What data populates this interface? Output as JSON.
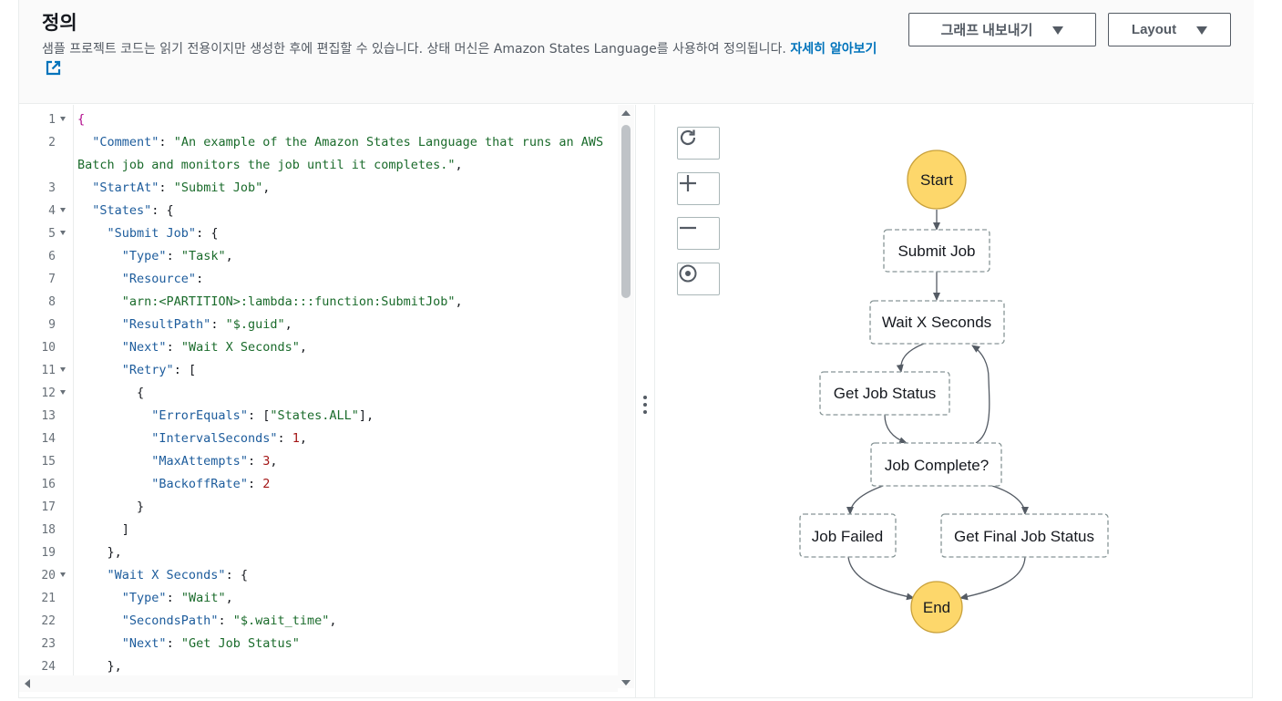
{
  "header": {
    "title": "정의",
    "description": "샘플 프로젝트 코드는 읽기 전용이지만 생성한 후에 편집할 수 있습니다. 상태 머신은 Amazon States Language를 사용하여 정의됩니다.",
    "learn_more": "자세히 알아보기",
    "export_button": "그래프 내보내기",
    "layout_button": "Layout"
  },
  "editor": {
    "lines": [
      {
        "n": "1",
        "fold": true,
        "html": "<span class='b'>{</span>"
      },
      {
        "n": "2",
        "fold": false,
        "html": "  <span class='k'>\"Comment\"</span>: <span class='s'>\"An example of the Amazon States Language that runs an AWS</span>"
      },
      {
        "n": "",
        "fold": false,
        "html": "<span class='s'>Batch job and monitors the job until it completes.\"</span>,"
      },
      {
        "n": "3",
        "fold": false,
        "html": "  <span class='k'>\"StartAt\"</span>: <span class='s'>\"Submit Job\"</span>,"
      },
      {
        "n": "4",
        "fold": true,
        "html": "  <span class='k'>\"States\"</span>: {"
      },
      {
        "n": "5",
        "fold": true,
        "html": "    <span class='k'>\"Submit Job\"</span>: {"
      },
      {
        "n": "6",
        "fold": false,
        "html": "      <span class='k'>\"Type\"</span>: <span class='s'>\"Task\"</span>,"
      },
      {
        "n": "7",
        "fold": false,
        "html": "      <span class='k'>\"Resource\"</span>:"
      },
      {
        "n": "8",
        "fold": false,
        "html": "      <span class='s'>\"arn:&lt;PARTITION&gt;:lambda:::function:SubmitJob\"</span>,"
      },
      {
        "n": "9",
        "fold": false,
        "html": "      <span class='k'>\"ResultPath\"</span>: <span class='s'>\"$.guid\"</span>,"
      },
      {
        "n": "10",
        "fold": false,
        "html": "      <span class='k'>\"Next\"</span>: <span class='s'>\"Wait X Seconds\"</span>,"
      },
      {
        "n": "11",
        "fold": true,
        "html": "      <span class='k'>\"Retry\"</span>: ["
      },
      {
        "n": "12",
        "fold": true,
        "html": "        {"
      },
      {
        "n": "13",
        "fold": false,
        "html": "          <span class='k'>\"ErrorEquals\"</span>: [<span class='s'>\"States.ALL\"</span>],"
      },
      {
        "n": "14",
        "fold": false,
        "html": "          <span class='k'>\"IntervalSeconds\"</span>: <span class='n'>1</span>,"
      },
      {
        "n": "15",
        "fold": false,
        "html": "          <span class='k'>\"MaxAttempts\"</span>: <span class='n'>3</span>,"
      },
      {
        "n": "16",
        "fold": false,
        "html": "          <span class='k'>\"BackoffRate\"</span>: <span class='n'>2</span>"
      },
      {
        "n": "17",
        "fold": false,
        "html": "        }"
      },
      {
        "n": "18",
        "fold": false,
        "html": "      ]"
      },
      {
        "n": "19",
        "fold": false,
        "html": "    },"
      },
      {
        "n": "20",
        "fold": true,
        "html": "    <span class='k'>\"Wait X Seconds\"</span>: {"
      },
      {
        "n": "21",
        "fold": false,
        "html": "      <span class='k'>\"Type\"</span>: <span class='s'>\"Wait\"</span>,"
      },
      {
        "n": "22",
        "fold": false,
        "html": "      <span class='k'>\"SecondsPath\"</span>: <span class='s'>\"$.wait_time\"</span>,"
      },
      {
        "n": "23",
        "fold": false,
        "html": "      <span class='k'>\"Next\"</span>: <span class='s'>\"Get Job Status\"</span>"
      },
      {
        "n": "24",
        "fold": false,
        "html": "    },"
      }
    ]
  },
  "graph": {
    "controls": [
      "refresh-icon",
      "zoom-in-icon",
      "zoom-out-icon",
      "center-icon"
    ],
    "nodes": {
      "start": "Start",
      "submit": "Submit Job",
      "wait": "Wait X Seconds",
      "status": "Get Job Status",
      "complete": "Job Complete?",
      "failed": "Job Failed",
      "final": "Get Final Job Status",
      "end": "End"
    },
    "colors": {
      "terminal": "#fdd76b",
      "terminal_stroke": "#c8a03a",
      "node_stroke": "#879596",
      "edge": "#545b64"
    }
  }
}
